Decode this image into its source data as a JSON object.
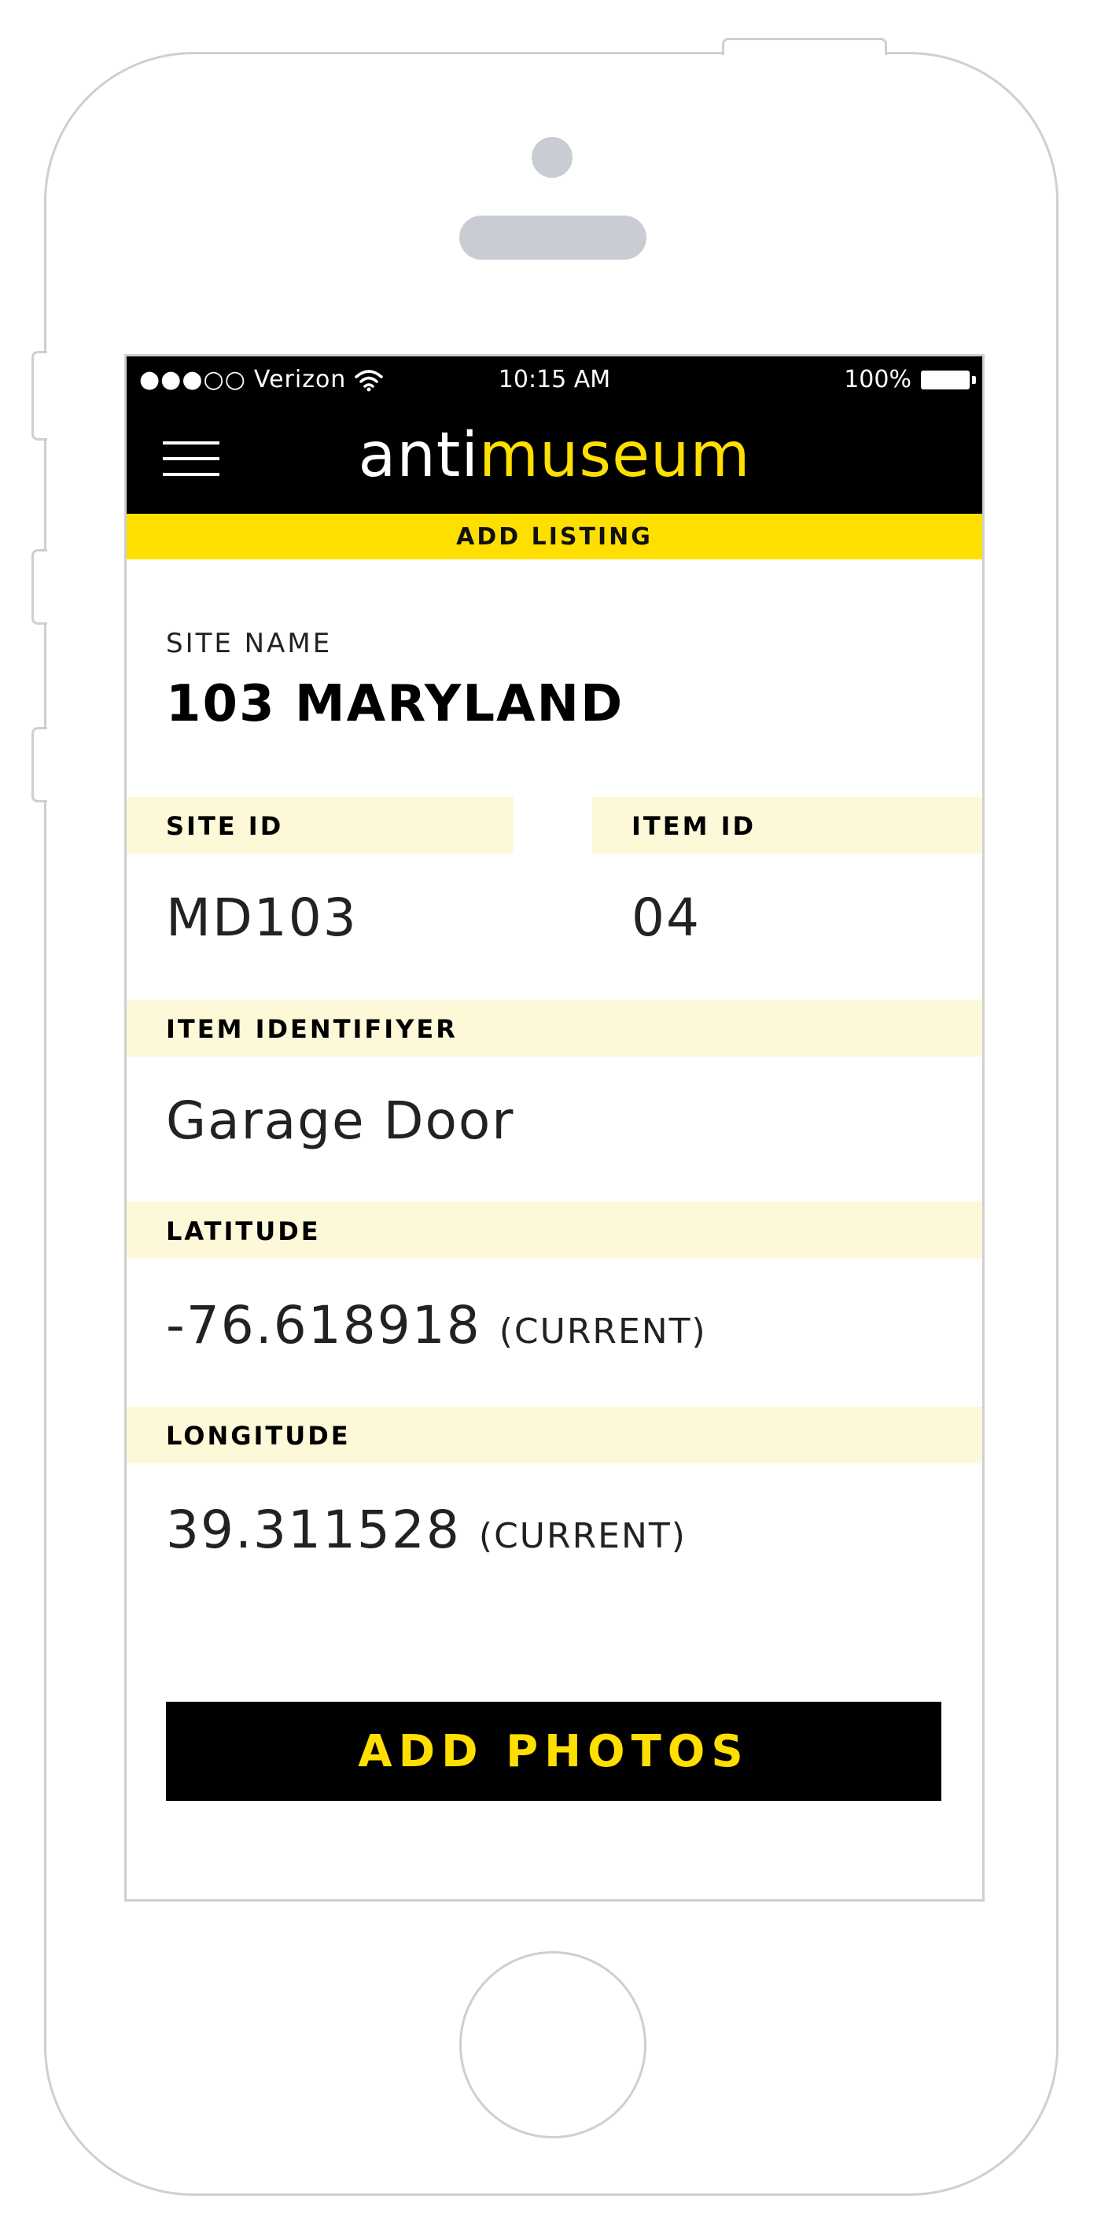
{
  "status_bar": {
    "signal": "●●●○○",
    "carrier": "Verizon",
    "time": "10:15 AM",
    "battery": "100%"
  },
  "header": {
    "logo_prefix": "anti",
    "logo_suffix": "museum",
    "section_title": "ADD LISTING"
  },
  "site": {
    "label": "SITE NAME",
    "value": "103 MARYLAND"
  },
  "fields": {
    "site_id_label": "SITE ID",
    "site_id_value": "MD103",
    "item_id_label": "ITEM ID",
    "item_id_value": "04",
    "identifier_label": "ITEM IDENTIFIYER",
    "identifier_value": "Garage Door",
    "latitude_label": "LATITUDE",
    "latitude_value": "-76.618918",
    "longitude_label": "LONGITUDE",
    "longitude_value": "39.311528",
    "current_note": "(CURRENT)"
  },
  "actions": {
    "add_photos": "ADD PHOTOS"
  },
  "colors": {
    "accent": "#ffdf00",
    "band": "#fdf8d8",
    "header": "#000000"
  }
}
